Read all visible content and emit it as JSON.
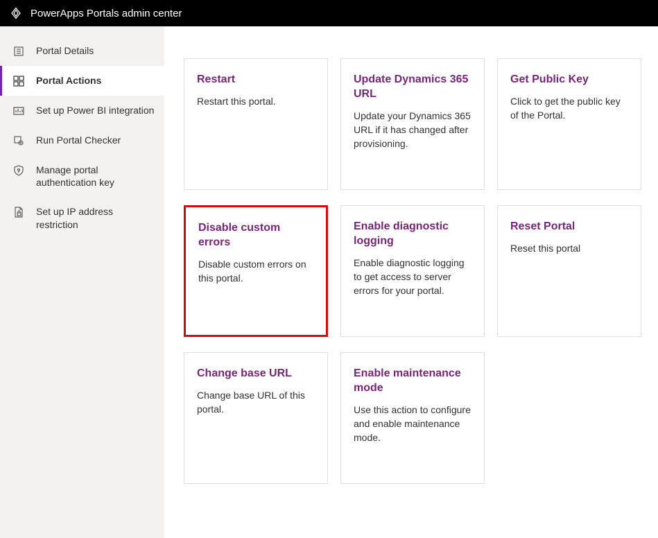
{
  "header": {
    "title": "PowerApps Portals admin center"
  },
  "sidebar": {
    "items": [
      {
        "label": "Portal Details"
      },
      {
        "label": "Portal Actions"
      },
      {
        "label": "Set up Power BI integration"
      },
      {
        "label": "Run Portal Checker"
      },
      {
        "label": "Manage portal authentication key"
      },
      {
        "label": "Set up IP address restriction"
      }
    ]
  },
  "cards": [
    {
      "title": "Restart",
      "desc": "Restart this portal."
    },
    {
      "title": "Update Dynamics 365 URL",
      "desc": "Update your Dynamics 365 URL if it has changed after provisioning."
    },
    {
      "title": "Get Public Key",
      "desc": "Click to get the public key of the Portal."
    },
    {
      "title": "Disable custom errors",
      "desc": "Disable custom errors on this portal."
    },
    {
      "title": "Enable diagnostic logging",
      "desc": "Enable diagnostic logging to get access to server errors for your portal."
    },
    {
      "title": "Reset Portal",
      "desc": "Reset this portal"
    },
    {
      "title": "Change base URL",
      "desc": "Change base URL of this portal."
    },
    {
      "title": "Enable maintenance mode",
      "desc": "Use this action to configure and enable maintenance mode."
    }
  ]
}
